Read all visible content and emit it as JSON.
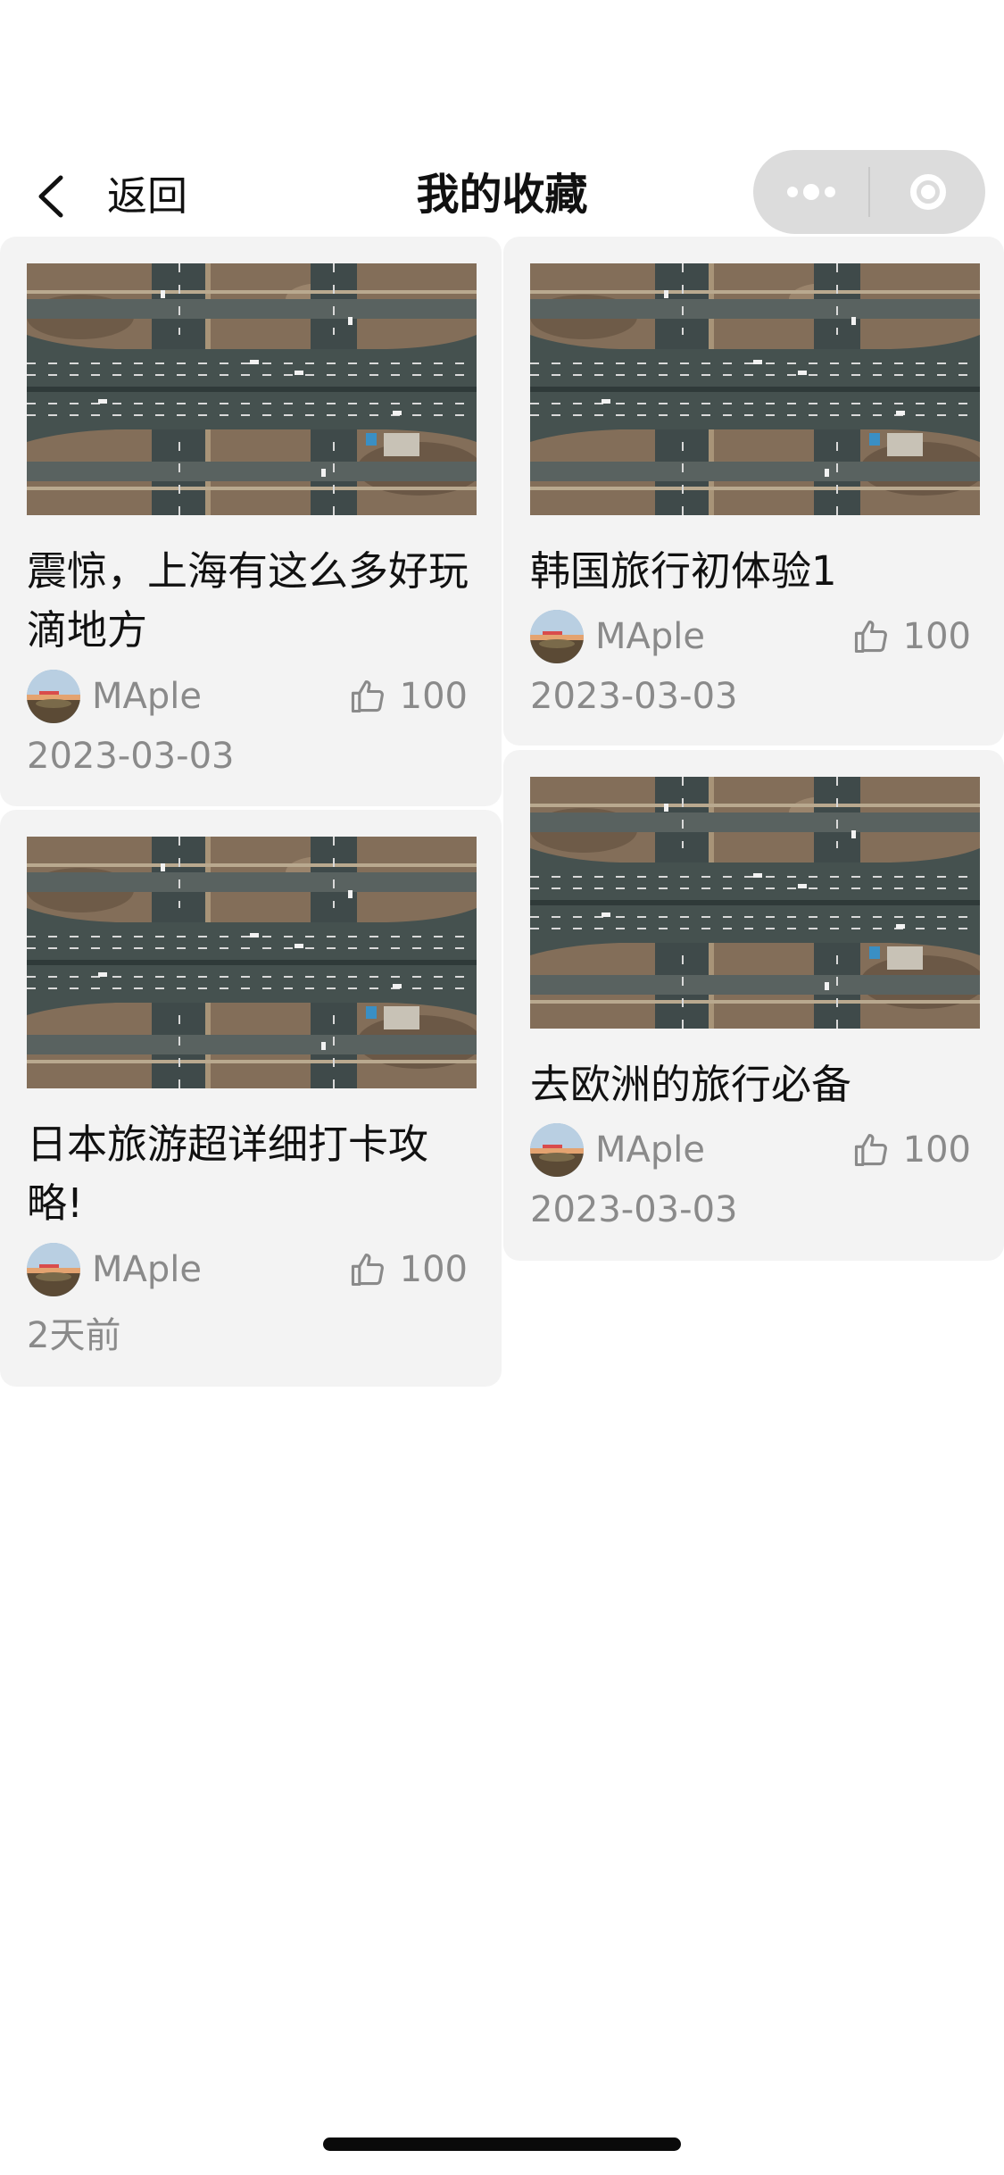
{
  "nav": {
    "back_label": "返回",
    "title": "我的收藏",
    "icons": {
      "back": "chevron-left-icon",
      "more": "more-dots-icon",
      "close": "target-circle-icon"
    }
  },
  "cards": [
    {
      "title": "震惊，上海有这么多好玩滴地方",
      "author": "MAple",
      "likes": "100",
      "date": "2023-03-03"
    },
    {
      "title": "韩国旅行初体验1",
      "author": "MAple",
      "likes": "100",
      "date": "2023-03-03"
    },
    {
      "title": "日本旅游超详细打卡攻略!",
      "author": "MAple",
      "likes": "100",
      "date": "2天前"
    },
    {
      "title": "去欧洲的旅行必备",
      "author": "MAple",
      "likes": "100",
      "date": "2023-03-03"
    }
  ],
  "colors": {
    "card_bg": "#f3f3f3",
    "meta_text": "#8a8a8a",
    "capsule_bg": "#dcdcdc"
  }
}
